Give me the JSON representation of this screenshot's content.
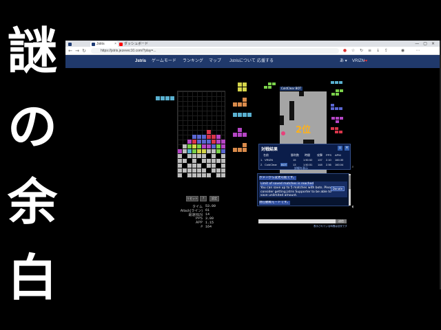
{
  "overlay": {
    "title_chars": [
      "謎",
      "の",
      "余",
      "白"
    ]
  },
  "browser": {
    "tabs": [
      {
        "label": "Jstris",
        "color": "#1e3b74"
      },
      {
        "label": "",
        "color": "#cc0000"
      },
      {
        "label": "ダッシュボード",
        "color": "#ff0000"
      },
      {
        "label": "",
        "color": "#ff0000"
      }
    ],
    "url": "https://jstris.jezevec10.com/?play=..."
  },
  "site": {
    "nav": {
      "brand": "Jstris",
      "game_mode": "ゲームモード",
      "ranking": "ランキング",
      "maps": "マップ",
      "about": "Jstrisについて",
      "support": "応援する",
      "user": "VRIZN"
    }
  },
  "game": {
    "controls": [
      "リセット",
      "?",
      "設定"
    ],
    "stats": [
      {
        "label": "タイム",
        "value": "53.09"
      },
      {
        "label": "Attack(ライン)",
        "value": "61"
      },
      {
        "label": "最速REN",
        "value": "14"
      },
      {
        "label": "PPS",
        "value": "3.09"
      },
      {
        "label": "APP",
        "value": "1.15"
      },
      {
        "label": "#",
        "value": "164"
      }
    ]
  },
  "opponent": {
    "name": "ColdClear",
    "tag": "BOT",
    "rank_label": "2位"
  },
  "results": {
    "title": "対戦結果",
    "columns": [
      "名前",
      "勝利数",
      "時間",
      "攻撃",
      "PPS",
      "APM"
    ],
    "rows": [
      [
        "1.",
        "VRIZN",
        "15",
        "1:50.52",
        "137",
        "2.10",
        "160.30"
      ],
      [
        "2.",
        "ColdClear",
        "13",
        "1:50.51",
        "148",
        "2.56",
        "160.04"
      ]
    ],
    "bot_badge": "BOT",
    "detail_link": "詳細を表示"
  },
  "chat": {
    "line1": "ボタンから変更可能です。",
    "notice_title": "Limit of saved matches is reached",
    "notice_lines": [
      "You can save up to 5 matches with bots. Please",
      "consider getting     Jstris Supporter to be able to",
      "save unlimited amount."
    ],
    "donate_label": "Donate",
    "last_line": "現在観戦モードです。",
    "send_label": "送信",
    "footer": "表示されている時間は目安です"
  }
}
